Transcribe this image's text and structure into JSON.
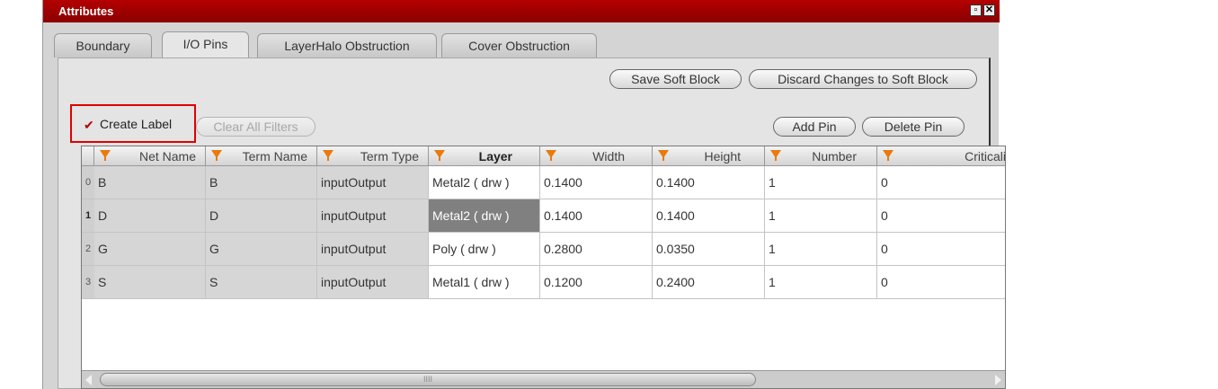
{
  "window": {
    "title": "Attributes"
  },
  "tabs": [
    {
      "label": "Boundary"
    },
    {
      "label": "I/O Pins"
    },
    {
      "label": "LayerHalo Obstruction"
    },
    {
      "label": "Cover Obstruction"
    }
  ],
  "buttons": {
    "save": "Save Soft Block",
    "discard": "Discard Changes to Soft Block",
    "clear_filters": "Clear All Filters",
    "add_pin": "Add Pin",
    "delete_pin": "Delete Pin"
  },
  "create_label": {
    "label": "Create Label",
    "checked": true
  },
  "table": {
    "columns": [
      "Net Name",
      "Term Name",
      "Term Type",
      "Layer",
      "Width",
      "Height",
      "Number",
      "Criticali"
    ],
    "rows": [
      {
        "index": "0",
        "cells": [
          "B",
          "B",
          "inputOutput",
          "Metal2 ( drw )",
          "0.1400",
          "0.1400",
          "1",
          "0"
        ]
      },
      {
        "index": "1",
        "cells": [
          "D",
          "D",
          "inputOutput",
          "Metal2 ( drw )",
          "0.1400",
          "0.1400",
          "1",
          "0"
        ]
      },
      {
        "index": "2",
        "cells": [
          "G",
          "G",
          "inputOutput",
          "Poly ( drw )",
          "0.2800",
          "0.0350",
          "1",
          "0"
        ]
      },
      {
        "index": "3",
        "cells": [
          "S",
          "S",
          "inputOutput",
          "Metal1 ( drw )",
          "0.1200",
          "0.2400",
          "1",
          "0"
        ]
      }
    ]
  },
  "colors": {
    "titlebar": "#a00000",
    "highlight_box": "#e00000",
    "selected_cell": "#808080",
    "filter_icon": "#e87a10"
  }
}
